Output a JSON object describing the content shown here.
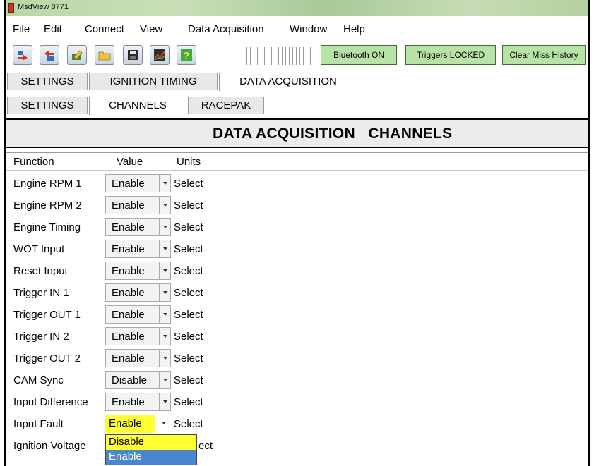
{
  "window": {
    "title": "MsdView  8771"
  },
  "menu": [
    "File",
    "Edit",
    "Connect",
    "View",
    "Data Acquisition",
    "Window",
    "Help"
  ],
  "toolbar": {
    "icons": [
      "send-to-device-icon",
      "read-from-device-icon",
      "edit-icon",
      "open-folder-icon",
      "save-disk-icon",
      "chart-icon",
      "help-icon"
    ],
    "buttons": [
      "Bluetooth ON",
      "Triggers LOCKED",
      "Clear Miss History"
    ],
    "accent": "#b7e3a7"
  },
  "tabs_main": [
    "SETTINGS",
    "IGNITION TIMING",
    "DATA ACQUISITION"
  ],
  "tabs_sub": [
    "SETTINGS",
    "CHANNELS",
    "RACEPAK"
  ],
  "header": {
    "title": "DATA ACQUISITION   CHANNELS"
  },
  "grid": {
    "columns": [
      "Function",
      "Value",
      "Units"
    ],
    "rows": [
      {
        "function": "Engine RPM 1",
        "value": "Enable",
        "units": "Select"
      },
      {
        "function": "Engine RPM 2",
        "value": "Enable",
        "units": "Select"
      },
      {
        "function": "Engine Timing",
        "value": "Enable",
        "units": "Select"
      },
      {
        "function": "WOT Input",
        "value": "Enable",
        "units": "Select"
      },
      {
        "function": "Reset Input",
        "value": "Enable",
        "units": "Select"
      },
      {
        "function": "Trigger IN 1",
        "value": "Enable",
        "units": "Select"
      },
      {
        "function": "Trigger OUT 1",
        "value": "Enable",
        "units": "Select"
      },
      {
        "function": "Trigger IN 2",
        "value": "Enable",
        "units": "Select"
      },
      {
        "function": "Trigger OUT 2",
        "value": "Enable",
        "units": "Select"
      },
      {
        "function": "CAM Sync",
        "value": "Disable",
        "units": "Select"
      },
      {
        "function": "Input Difference",
        "value": "Enable",
        "units": "Select"
      },
      {
        "function": "Input Fault",
        "value": "Enable",
        "units": "Select"
      },
      {
        "function": "Ignition Voltage",
        "value": "",
        "units": "ect"
      }
    ]
  },
  "dropdown": {
    "options": [
      "Disable",
      "Enable"
    ],
    "highlight": "#ffff33",
    "selected_bg": "#4a86cf"
  }
}
